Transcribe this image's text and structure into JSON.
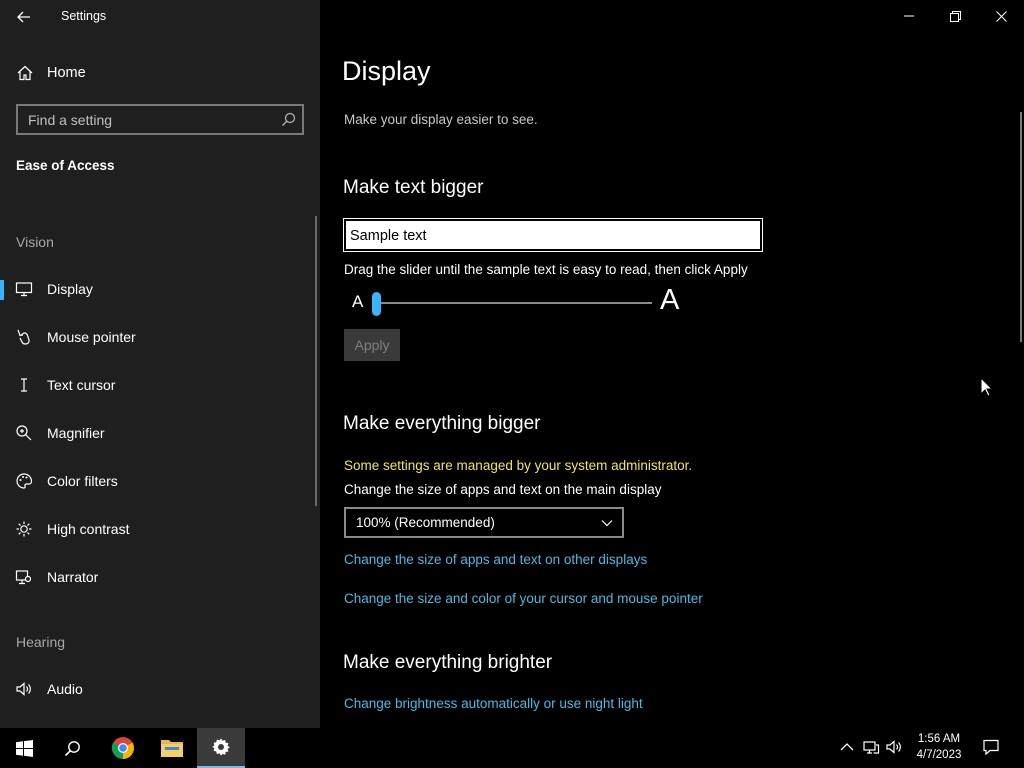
{
  "window": {
    "app_title": "Settings"
  },
  "sidebar": {
    "home_label": "Home",
    "search_placeholder": "Find a setting",
    "category": "Ease of Access",
    "groups": {
      "vision": "Vision",
      "hearing": "Hearing"
    },
    "items": [
      {
        "label": "Display",
        "icon": "monitor-icon",
        "active": true
      },
      {
        "label": "Mouse pointer",
        "icon": "mouse-pointer-icon"
      },
      {
        "label": "Text cursor",
        "icon": "text-cursor-icon"
      },
      {
        "label": "Magnifier",
        "icon": "magnifier-icon"
      },
      {
        "label": "Color filters",
        "icon": "palette-icon"
      },
      {
        "label": "High contrast",
        "icon": "contrast-icon"
      },
      {
        "label": "Narrator",
        "icon": "narrator-icon"
      },
      {
        "label": "Audio",
        "icon": "speaker-icon"
      }
    ]
  },
  "main": {
    "title": "Display",
    "subtitle": "Make your display easier to see.",
    "text_bigger": {
      "heading": "Make text bigger",
      "sample": "Sample text",
      "help": "Drag the slider until the sample text is easy to read, then click Apply",
      "small_a": "A",
      "big_a": "A",
      "slider_value": 0,
      "apply_label": "Apply"
    },
    "everything_bigger": {
      "heading": "Make everything bigger",
      "admin_note": "Some settings are managed by your system administrator.",
      "label": "Change the size of apps and text on the main display",
      "selected": "100% (Recommended)",
      "link_other_displays": "Change the size of apps and text on other displays",
      "link_cursor": "Change the size and color of your cursor and mouse pointer"
    },
    "everything_brighter": {
      "heading": "Make everything brighter",
      "link_brightness": "Change brightness automatically or use night light"
    }
  },
  "taskbar": {
    "time": "1:56 AM",
    "date": "4/7/2023",
    "pinned": [
      "start-icon",
      "search-icon",
      "chrome-icon",
      "file-explorer-icon",
      "settings-icon"
    ]
  },
  "colors": {
    "accent": "#38b4ff",
    "link": "#4db8e3",
    "warning": "#f1e35c",
    "sidebar_bg": "#1f1f1f"
  }
}
